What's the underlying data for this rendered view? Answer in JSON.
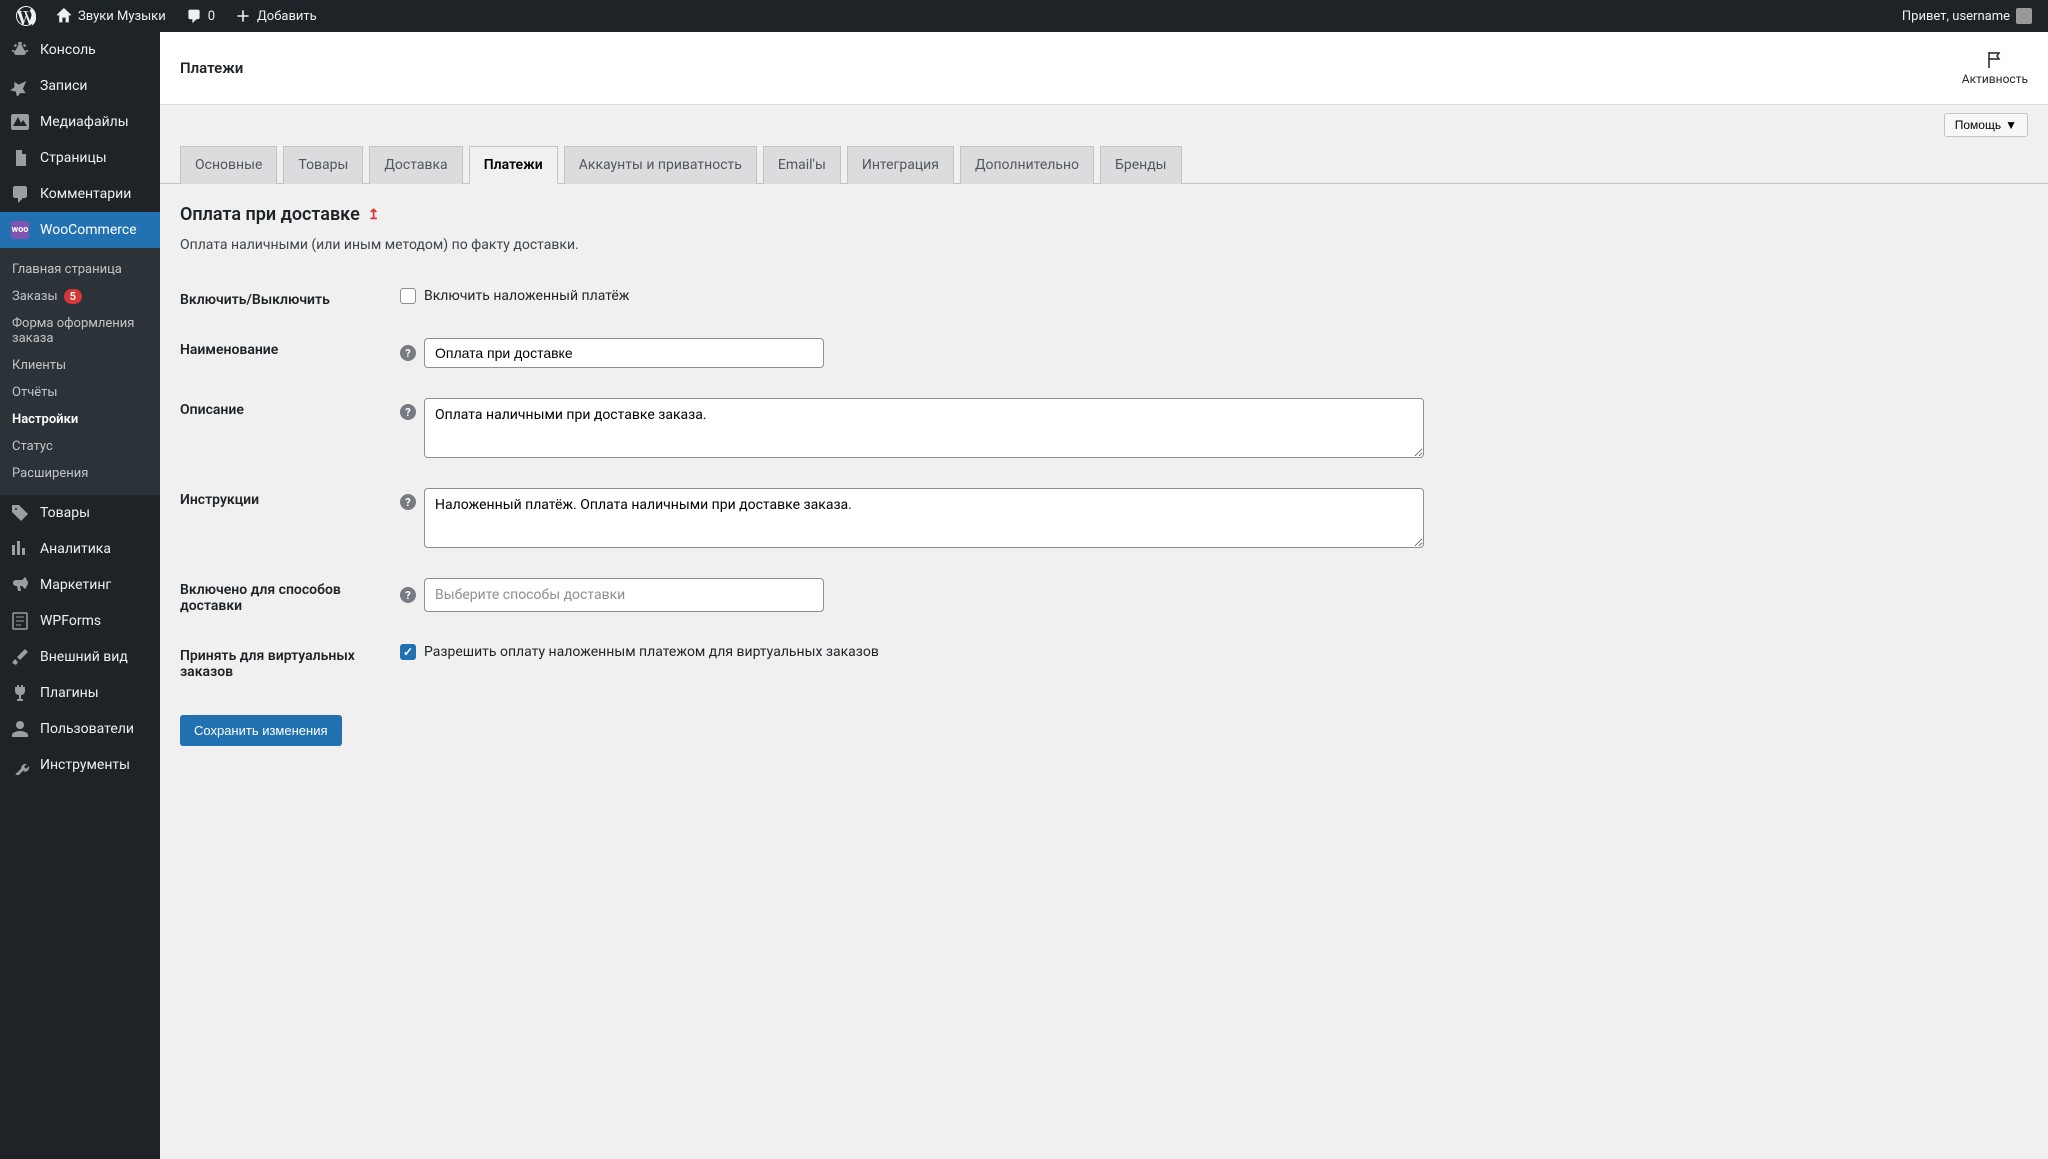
{
  "adminbar": {
    "site_name": "Звуки Музыки",
    "comments_count": "0",
    "add_new": "Добавить",
    "greeting": "Привет, username"
  },
  "sidebar": {
    "console": "Консоль",
    "posts": "Записи",
    "media": "Медиафайлы",
    "pages": "Страницы",
    "comments": "Комментарии",
    "woocommerce": "WooCommerce",
    "woo_sub": {
      "home": "Главная страница",
      "orders": "Заказы",
      "orders_badge": "5",
      "checkout_form": "Форма оформления заказа",
      "customers": "Клиенты",
      "reports": "Отчёты",
      "settings": "Настройки",
      "status": "Статус",
      "extensions": "Расширения"
    },
    "products": "Товары",
    "analytics": "Аналитика",
    "marketing": "Маркетинг",
    "wpforms": "WPForms",
    "appearance": "Внешний вид",
    "plugins": "Плагины",
    "users": "Пользователи",
    "tools": "Инструменты"
  },
  "header": {
    "title": "Платежи",
    "activity": "Активность",
    "help": "Помощь"
  },
  "tabs": {
    "general": "Основные",
    "products": "Товары",
    "shipping": "Доставка",
    "payments": "Платежи",
    "accounts": "Аккаунты и приватность",
    "emails": "Email'ы",
    "integration": "Интеграция",
    "advanced": "Дополнительно",
    "brands": "Бренды"
  },
  "section": {
    "title": "Оплата при доставке",
    "back_icon": "↥",
    "desc": "Оплата наличными (или иным методом) по факту доставки."
  },
  "fields": {
    "enable": {
      "label": "Включить/Выключить",
      "checkbox_label": "Включить наложенный платёж",
      "checked": false
    },
    "title": {
      "label": "Наименование",
      "value": "Оплата при доставке"
    },
    "description": {
      "label": "Описание",
      "value": "Оплата наличными при доставке заказа."
    },
    "instructions": {
      "label": "Инструкции",
      "value": "Наложенный платёж. Оплата наличными при доставке заказа."
    },
    "shipping_methods": {
      "label": "Включено для способов доставки",
      "placeholder": "Выберите способы доставки"
    },
    "virtual": {
      "label": "Принять для виртуальных заказов",
      "checkbox_label": "Разрешить оплату наложенным платежом для виртуальных заказов",
      "checked": true
    }
  },
  "save_button": "Сохранить изменения"
}
